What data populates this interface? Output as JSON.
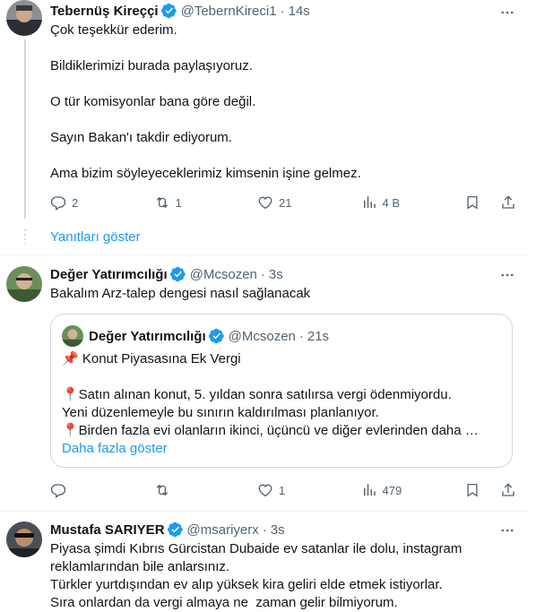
{
  "tweet1": {
    "name": "Tebernüş Kireççi",
    "handle": "@TebernKireci1",
    "time": "14s",
    "lines": [
      "Çok teşekkür ederim.",
      "Bildiklerimizi burada paylaşıyoruz.",
      "O tür komisyonlar bana göre değil.",
      "Sayın Bakan'ı takdir ediyorum.",
      "Ama bizim söyleyeceklerimiz kimsenin işine gelmez."
    ],
    "replies": "2",
    "retweets": "1",
    "likes": "21",
    "views": "4 B",
    "show_replies": "Yanıtları göster"
  },
  "tweet2": {
    "name": "Değer Yatırımcılığı",
    "handle": "@Mcsozen",
    "time": "3s",
    "text": "Bakalım Arz-talep dengesi nasıl sağlanacak",
    "replies": "",
    "retweets": "",
    "likes": "1",
    "views": "479",
    "quote": {
      "name": "Değer Yatırımcılığı",
      "handle": "@Mcsozen",
      "time": "21s",
      "title": "📌 Konut Piyasasına Ek Vergi",
      "line1": "📍Satın alınan konut, 5. yıldan sonra satılırsa vergi ödenmiyordu.",
      "line2": "Yeni düzenlemeyle bu sınırın kaldırılması planlanıyor.",
      "line3": "📍Birden fazla evi olanların ikinci, üçüncü ve diğer evlerinden daha …",
      "show_more": "Daha fazla göster"
    }
  },
  "tweet3": {
    "name": "Mustafa SARIYER",
    "handle": "@msariyerx",
    "time": "3s",
    "lines": [
      "Piyasa şimdi Kıbrıs Gürcistan Dubaide ev satanlar ile dolu, instagram",
      "reklamlarından bile anlarsınız.",
      "Türkler yurtdışından ev alıp yüksek kira geliri elde etmek istiyorlar.",
      "Sıra onlardan da vergi almaya ne  zaman gelir bilmiyorum."
    ]
  },
  "colors": {
    "accent": "#1d9bf0",
    "secondary": "#536471",
    "border": "#cfd9de"
  },
  "icons": [
    "more-icon",
    "verified-icon",
    "reply-icon",
    "retweet-icon",
    "like-icon",
    "views-icon",
    "bookmark-icon",
    "share-icon"
  ]
}
